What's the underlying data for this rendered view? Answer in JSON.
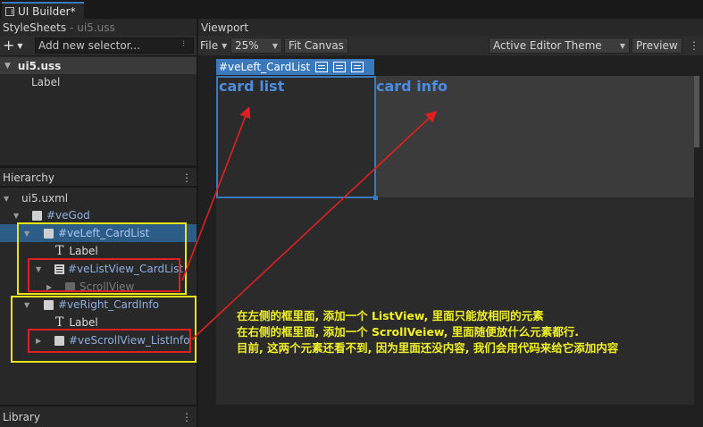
{
  "window": {
    "tab_title": "UI Builder*"
  },
  "stylesheets": {
    "header": "StyleSheets",
    "file": "- ui5.uss",
    "selector_placeholder": "Add new selector...",
    "uss_name": "ui5.uss",
    "selector_label": "Label"
  },
  "hierarchy": {
    "header": "Hierarchy",
    "root": "ui5.uxml",
    "items": [
      {
        "label": "#veGod"
      },
      {
        "label": "#veLeft_CardList"
      },
      {
        "label": "Label"
      },
      {
        "label": "#veListView_CardList"
      },
      {
        "label": "ScrollView"
      },
      {
        "label": "#veRight_CardInfo"
      },
      {
        "label": "Label"
      },
      {
        "label": "#veScrollView_ListInfo"
      }
    ]
  },
  "library": {
    "header": "Library"
  },
  "viewport": {
    "header": "Viewport",
    "file_menu": "File",
    "zoom": "25%",
    "fit_canvas": "Fit Canvas",
    "theme": "Active Editor Theme",
    "preview": "Preview",
    "selected_element": "#veLeft_CardList",
    "card_list_text": "card list",
    "card_info_text": "card info"
  },
  "annotation": {
    "line1": "在左侧的框里面, 添加一个 ListView, 里面只能放相同的元素",
    "line2": "在右侧的框里面, 添加一个 ScrollVeiew, 里面随便放什么元素都行.",
    "line3": "目前, 这两个元素还看不到, 因为里面还没内容, 我们会用代码来给它添加内容"
  },
  "colors": {
    "selection": "#2c5d87",
    "accent": "#3a79bb",
    "highlight_yellow": "#e5e51a",
    "highlight_red": "#e02020",
    "card_title": "#4b8ce0"
  }
}
